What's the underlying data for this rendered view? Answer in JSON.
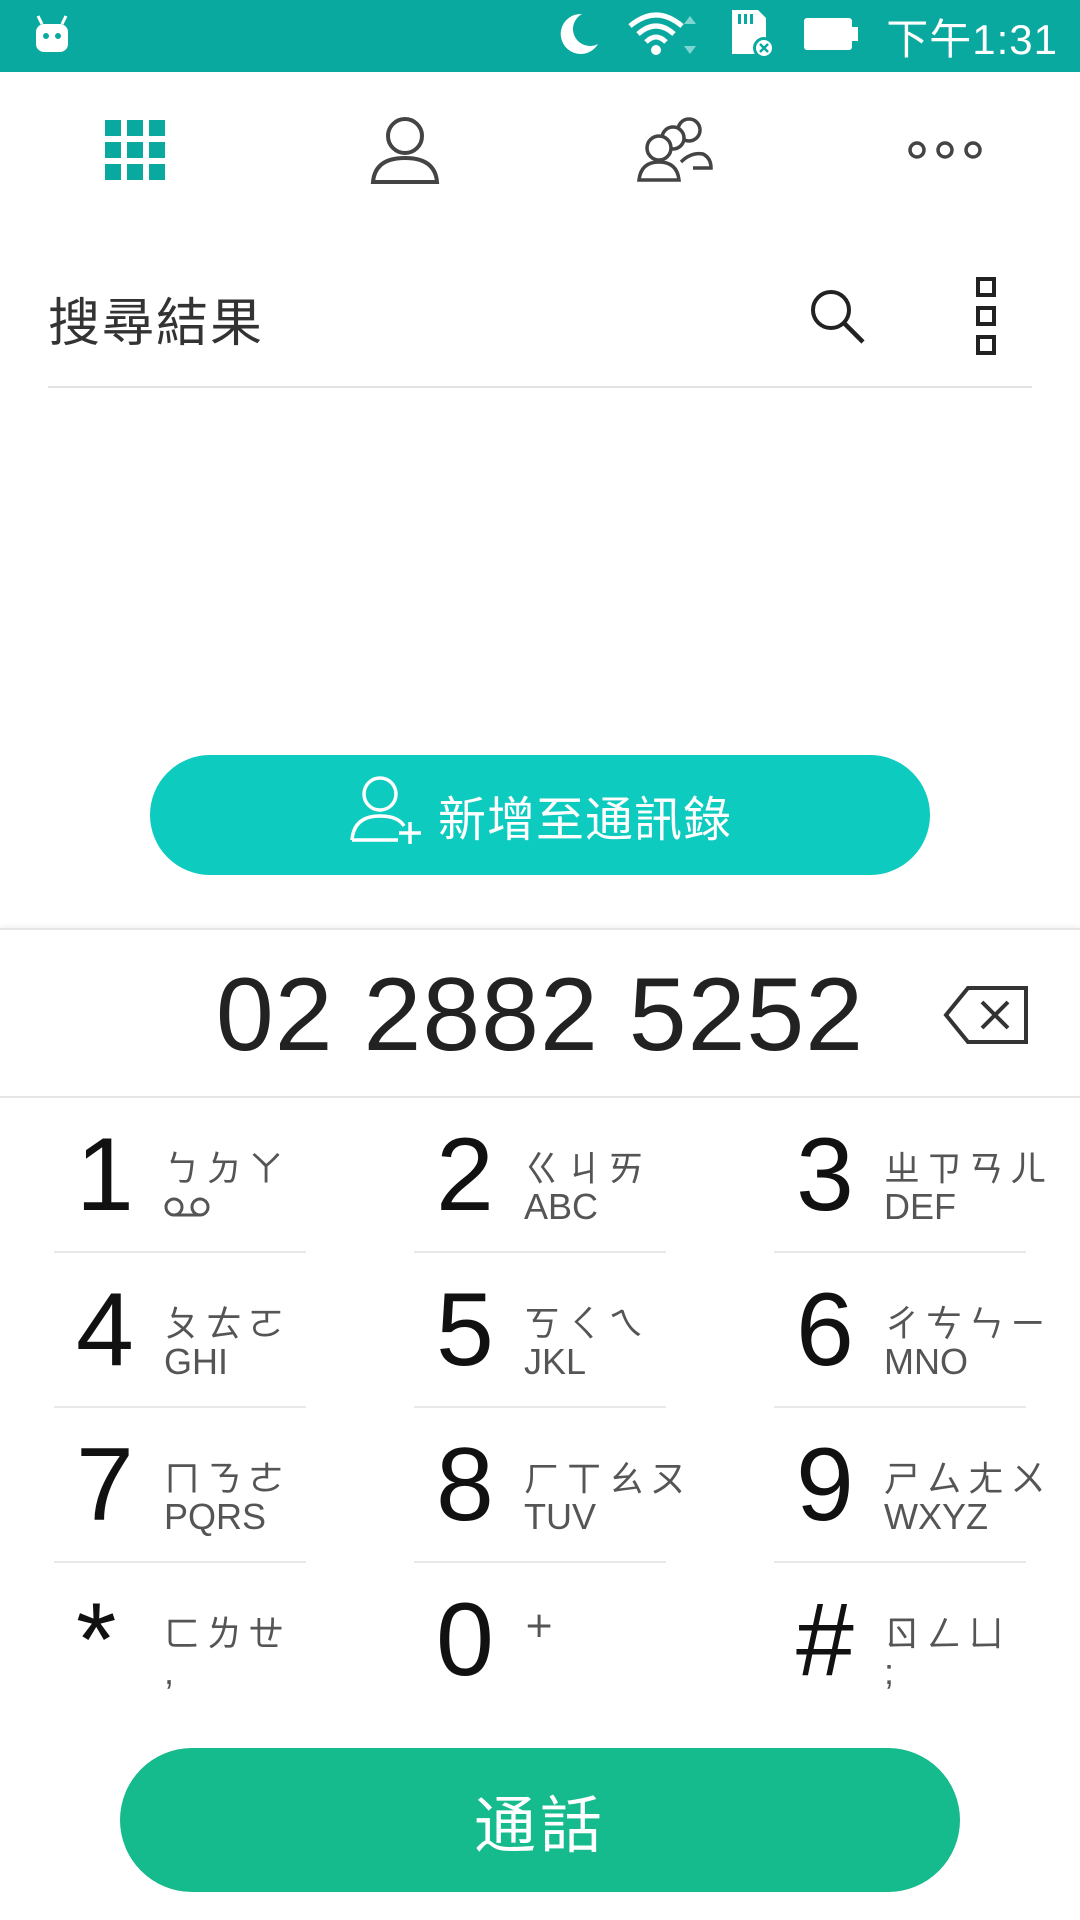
{
  "status_bar": {
    "time": "下午1:31",
    "icons": [
      "android-icon",
      "moon-icon",
      "wifi-icon",
      "sd-card-icon",
      "battery-icon"
    ],
    "background": "#0aa9a0"
  },
  "tabs": [
    {
      "name": "dialpad",
      "icon": "dialpad-grid-icon",
      "active": true
    },
    {
      "name": "contacts",
      "icon": "person-icon",
      "active": false
    },
    {
      "name": "groups",
      "icon": "group-icon",
      "active": false
    },
    {
      "name": "more",
      "icon": "more-dots-icon",
      "active": false
    }
  ],
  "results": {
    "title": "搜尋結果"
  },
  "add_contact": {
    "label": "新增至通訊錄"
  },
  "dialer": {
    "number": "02 2882 5252"
  },
  "keys": [
    {
      "digit": "1",
      "zhuyin": "ㄅㄉㄚ",
      "letters": "ㄛㄛ"
    },
    {
      "digit": "2",
      "zhuyin": "ㄍㄐㄞ",
      "letters": "ABC"
    },
    {
      "digit": "3",
      "zhuyin": "ㄓㄗㄢㄦ",
      "letters": "DEF"
    },
    {
      "digit": "4",
      "zhuyin": "ㄆㄊㄛ",
      "letters": "GHI"
    },
    {
      "digit": "5",
      "zhuyin": "ㄎㄑㄟ",
      "letters": "JKL"
    },
    {
      "digit": "6",
      "zhuyin": "ㄔㄘㄣㄧ",
      "letters": "MNO"
    },
    {
      "digit": "7",
      "zhuyin": "ㄇㄋㄜ",
      "letters": "PQRS"
    },
    {
      "digit": "8",
      "zhuyin": "ㄏㄒㄠㄡ",
      "letters": "TUV"
    },
    {
      "digit": "9",
      "zhuyin": "ㄕㄙㄤㄨ",
      "letters": "WXYZ"
    },
    {
      "digit": "*",
      "zhuyin": "ㄈㄌㄝ",
      "letters": ","
    },
    {
      "digit": "0",
      "zhuyin": "+",
      "letters": ""
    },
    {
      "digit": "#",
      "zhuyin": "ㄖㄥㄩ",
      "letters": ";"
    }
  ],
  "call_button": {
    "label": "通話",
    "color": "#16bb8d"
  },
  "colors": {
    "accent": "#0ecbbf",
    "dialpad_active": "#0aa9a0"
  }
}
